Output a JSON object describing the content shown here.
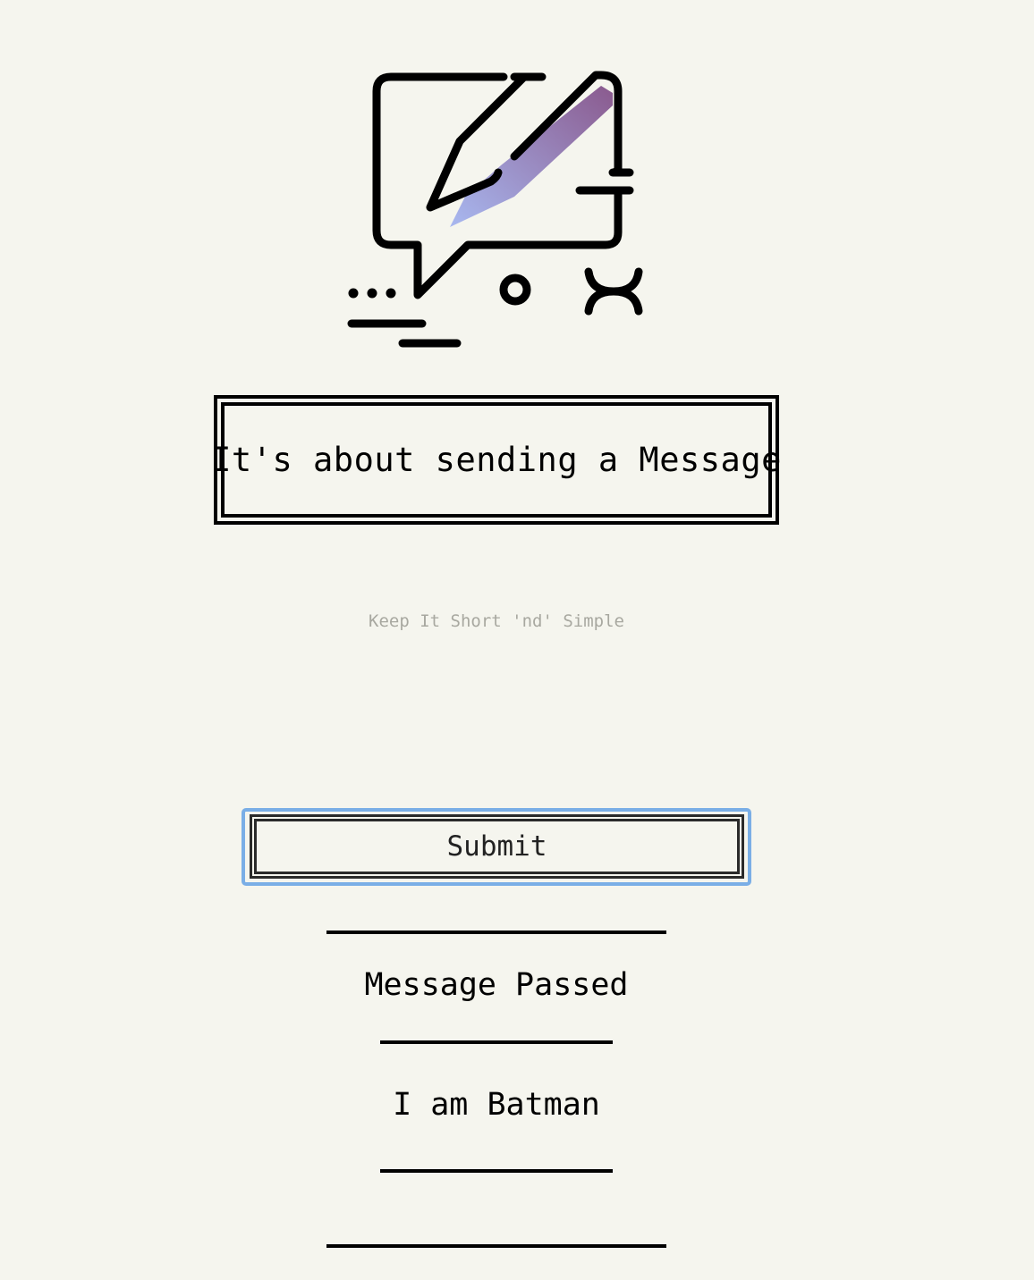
{
  "header": {
    "logo_icon": "message-edit-icon",
    "title": "It's about sending a Message"
  },
  "form": {
    "message_placeholder": "Keep It Short 'nd' Simple",
    "message_value": "",
    "submit_label": "Submit"
  },
  "messages": {
    "heading": "Message Passed",
    "items": [
      "I am Batman"
    ]
  },
  "colors": {
    "background": "#f5f5ee",
    "focus_ring": "#7aaee6",
    "pen_gradient_start": "#8a5a8e",
    "pen_gradient_end": "#a8b8f0"
  }
}
